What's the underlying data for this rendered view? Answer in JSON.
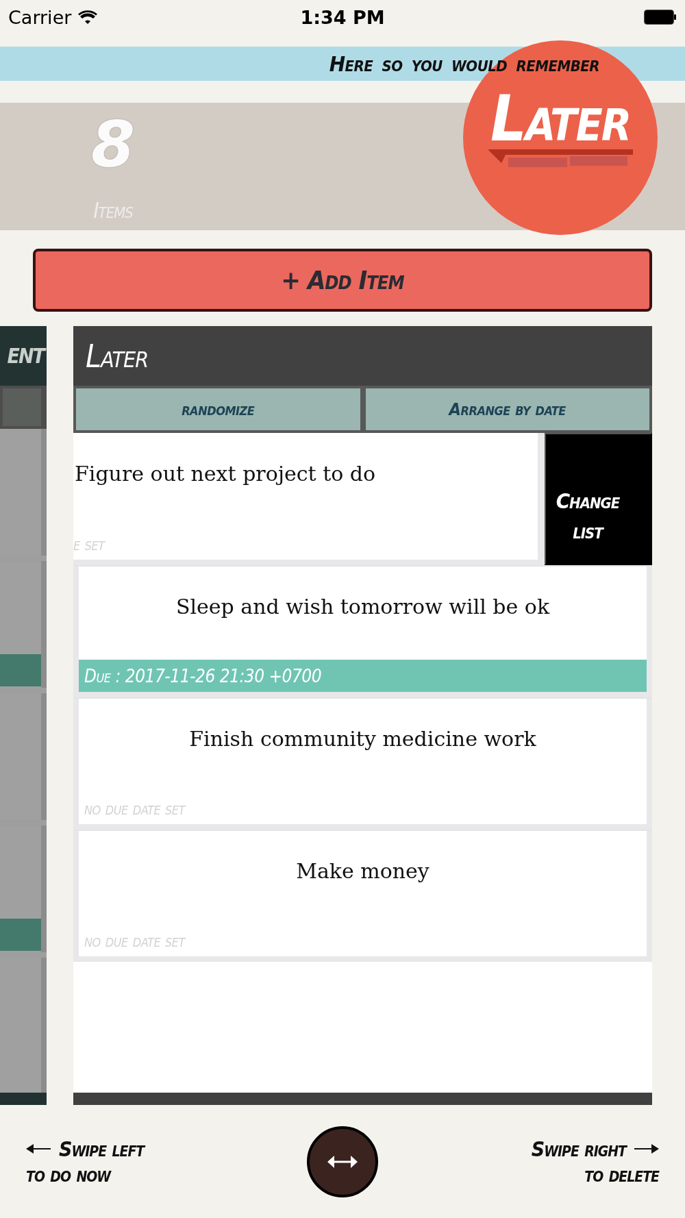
{
  "status_bar": {
    "carrier": "Carrier",
    "time": "1:34 PM"
  },
  "banner": {
    "text": "Here so you would remember"
  },
  "logo": {
    "text": "Later"
  },
  "stats": {
    "count": "8",
    "label": "Items"
  },
  "add_button": {
    "label": "+ Add Item"
  },
  "side_list": {
    "title": "ENT",
    "cards": [
      {
        "due_set": false
      },
      {
        "due_set": true
      },
      {
        "due_set": false
      },
      {
        "due_set": true
      },
      {
        "due_set": false
      }
    ]
  },
  "list": {
    "title": "Later",
    "buttons": [
      "randomize",
      "Arrange by date"
    ],
    "cards": [
      {
        "title": "Figure out next project to do",
        "due_label": "e set",
        "due_set": false,
        "swiped": true,
        "action": "Change list"
      },
      {
        "title": "Sleep and wish tomorrow will be ok",
        "due_label": "Due : 2017-11-26 21:30 +0700",
        "due_set": true,
        "swiped": false
      },
      {
        "title": "Finish community medicine work",
        "due_label": "no due date set",
        "due_set": false,
        "swiped": false
      },
      {
        "title": "Make money",
        "due_label": "no due date set",
        "due_set": false,
        "swiped": false
      }
    ]
  },
  "footer": {
    "left": {
      "title": "Swipe left",
      "subtitle": "to do now"
    },
    "right": {
      "title": "Swipe right",
      "subtitle": "to delete"
    }
  }
}
